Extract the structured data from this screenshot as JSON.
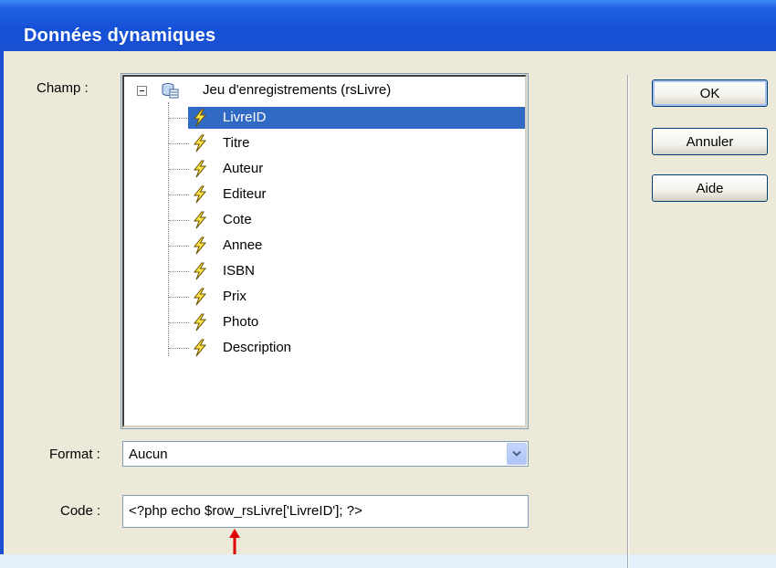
{
  "window": {
    "title": "Données dynamiques"
  },
  "labels": {
    "champ": "Champ :",
    "format": "Format :",
    "code": "Code :"
  },
  "tree": {
    "root_label": "Jeu d'enregistrements (rsLivre)",
    "items": [
      {
        "label": "LivreID",
        "selected": true
      },
      {
        "label": "Titre"
      },
      {
        "label": "Auteur"
      },
      {
        "label": "Editeur"
      },
      {
        "label": "Cote"
      },
      {
        "label": "Annee"
      },
      {
        "label": "ISBN"
      },
      {
        "label": "Prix"
      },
      {
        "label": "Photo"
      },
      {
        "label": "Description"
      }
    ]
  },
  "format": {
    "selected": "Aucun"
  },
  "code": {
    "value": "<?php echo $row_rsLivre['LivreID']; ?>"
  },
  "buttons": {
    "ok": "OK",
    "cancel": "Annuler",
    "help": "Aide"
  },
  "colors": {
    "titlebar": "#1a4fcf",
    "selection": "#316ac5",
    "annotation_arrow": "#e00000"
  },
  "icons": {
    "field": "lightning-bolt-icon",
    "recordset": "recordset-icon"
  }
}
